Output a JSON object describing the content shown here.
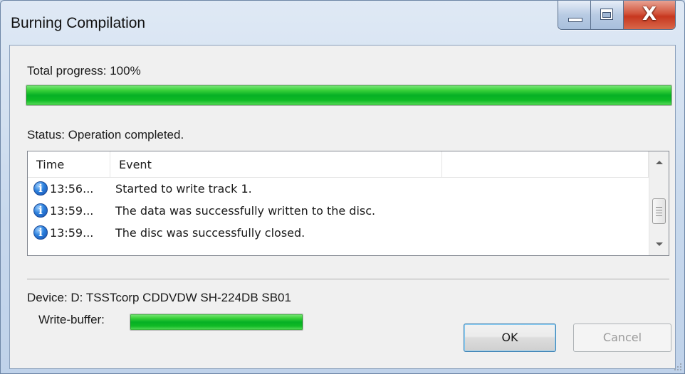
{
  "window": {
    "title": "Burning Compilation"
  },
  "progress": {
    "label": "Total progress: 100%",
    "value": 100
  },
  "status": {
    "text": "Status: Operation completed."
  },
  "log": {
    "columns": [
      "Time",
      "Event"
    ],
    "rows": [
      {
        "icon": "info-icon",
        "time": "13:56...",
        "event": "Started to write track 1."
      },
      {
        "icon": "info-icon",
        "time": "13:59...",
        "event": "The data was successfully written to the disc."
      },
      {
        "icon": "info-icon",
        "time": "13:59...",
        "event": "The disc was successfully closed."
      }
    ]
  },
  "device": {
    "text": "Device: D: TSSTcorp CDDVDW SH-224DB SB01"
  },
  "write_buffer": {
    "label": "Write-buffer:",
    "value": 100
  },
  "buttons": {
    "ok": "OK",
    "cancel": "Cancel"
  },
  "colors": {
    "progress_fill": "#06b025",
    "title_bar": "#c7d8ec",
    "close_button": "#c7371f"
  }
}
